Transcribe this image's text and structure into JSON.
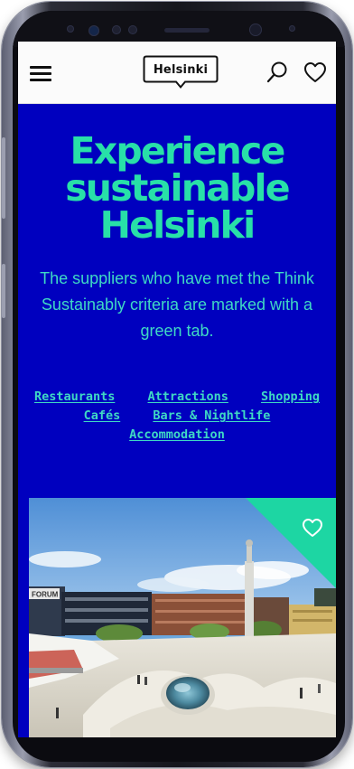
{
  "header": {
    "logo_text": "Helsinki",
    "menu_icon": "hamburger-menu-icon",
    "search_icon": "search-icon",
    "favorites_icon": "heart-icon"
  },
  "hero": {
    "title_lines": [
      "Experience",
      "sustainable",
      "Helsinki"
    ],
    "subtitle": "The suppliers who have met the Think Sustainably criteria are marked with a green tab."
  },
  "categories": [
    {
      "label": "Restaurants"
    },
    {
      "label": "Attractions"
    },
    {
      "label": "Shopping"
    },
    {
      "label": "Cafés"
    },
    {
      "label": "Bars & Nightlife"
    },
    {
      "label": "Accommodation"
    }
  ],
  "card": {
    "favorite_icon": "heart-outline-icon",
    "sign_text": "FORUM"
  },
  "colors": {
    "background": "#0000bf",
    "accent_green": "#28e0a8",
    "text_teal": "#3fd9c4",
    "green_tab": "#1dd6a3",
    "header_bg": "#fbfbfb"
  }
}
